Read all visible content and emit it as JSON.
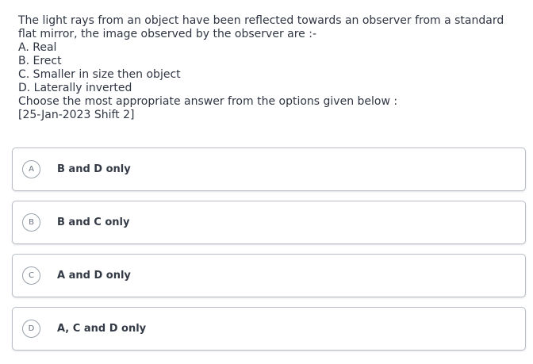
{
  "question": {
    "lines": [
      "The light rays from an object have been reflected towards an observer from a standard",
      "flat mirror, the image observed by the observer are :-",
      "A. Real",
      "B. Erect",
      "C. Smaller in size then object",
      "D. Laterally inverted",
      "Choose the most appropriate answer from the options given below :",
      "[25-Jan-2023 Shift 2]"
    ]
  },
  "options": [
    {
      "letter": "A",
      "label": "B and D only"
    },
    {
      "letter": "B",
      "label": "B and C only"
    },
    {
      "letter": "C",
      "label": "A and D only"
    },
    {
      "letter": "D",
      "label": "A, C and D only"
    }
  ]
}
